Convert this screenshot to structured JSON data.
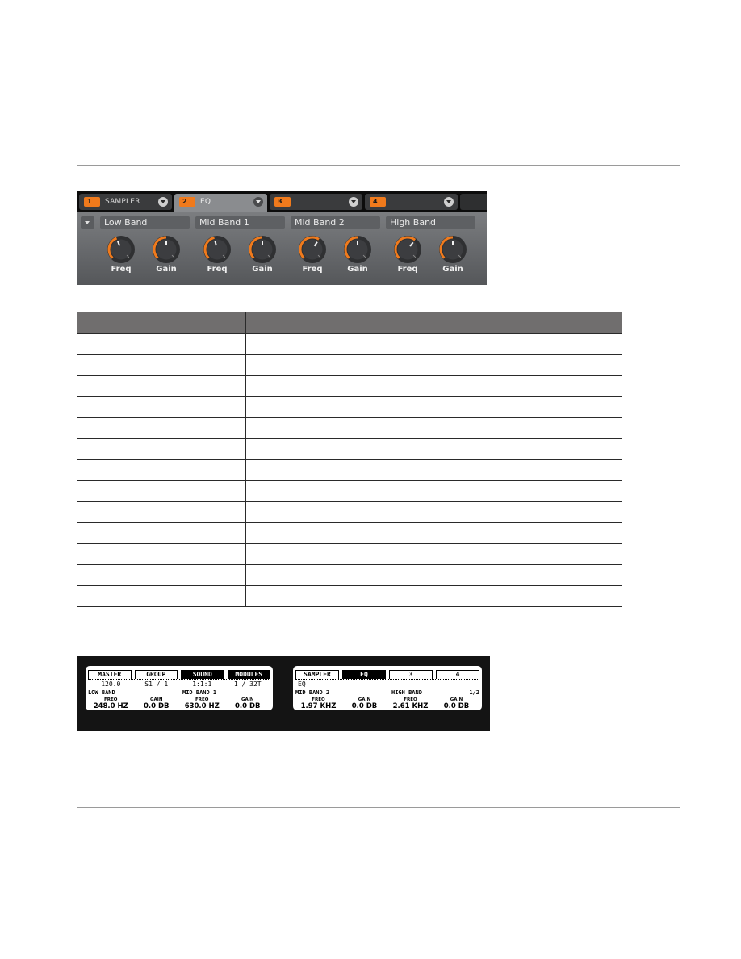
{
  "software_panel": {
    "slots": [
      {
        "number": "1",
        "name": "SAMPLER",
        "active": false
      },
      {
        "number": "2",
        "name": "EQ",
        "active": true
      },
      {
        "number": "3",
        "name": "",
        "active": false
      },
      {
        "number": "4",
        "name": "",
        "active": false
      }
    ],
    "bands": [
      {
        "label": "Low Band",
        "knobs": [
          {
            "label": "Freq",
            "value": 0.42
          },
          {
            "label": "Gain",
            "value": 0.5
          }
        ]
      },
      {
        "label": "Mid Band 1",
        "knobs": [
          {
            "label": "Freq",
            "value": 0.45
          },
          {
            "label": "Gain",
            "value": 0.5
          }
        ]
      },
      {
        "label": "Mid Band 2",
        "knobs": [
          {
            "label": "Freq",
            "value": 0.62
          },
          {
            "label": "Gain",
            "value": 0.5
          }
        ]
      },
      {
        "label": "High Band",
        "knobs": [
          {
            "label": "Freq",
            "value": 0.64
          },
          {
            "label": "Gain",
            "value": 0.5
          }
        ]
      }
    ],
    "accent_color": "#f07a1c"
  },
  "table": {
    "headers": [
      "",
      ""
    ],
    "rows": [
      [
        "",
        ""
      ],
      [
        "",
        ""
      ],
      [
        "",
        ""
      ],
      [
        "",
        ""
      ],
      [
        "",
        ""
      ],
      [
        "",
        ""
      ],
      [
        "",
        ""
      ],
      [
        "",
        ""
      ],
      [
        "",
        ""
      ],
      [
        "",
        ""
      ],
      [
        "",
        ""
      ],
      [
        "",
        ""
      ],
      [
        "",
        ""
      ]
    ]
  },
  "hardware_displays": {
    "left": {
      "tabs": [
        {
          "label": "MASTER",
          "selected": false
        },
        {
          "label": "GROUP",
          "selected": false
        },
        {
          "label": "SOUND",
          "selected": true
        },
        {
          "label": "MODULES",
          "selected": true
        }
      ],
      "row2": [
        "120.0",
        "S1 / 1",
        "1:1:1",
        "1 / 32T"
      ],
      "sections": [
        {
          "title": "LOW BAND",
          "page": ""
        },
        {
          "title": "MID BAND 1",
          "page": ""
        }
      ],
      "params": [
        {
          "caption": "FREQ",
          "value": "248.0 HZ"
        },
        {
          "caption": "GAIN",
          "value": "0.0 DB"
        },
        {
          "caption": "FREQ",
          "value": "630.0 HZ"
        },
        {
          "caption": "GAIN",
          "value": "0.0 DB"
        }
      ]
    },
    "right": {
      "tabs": [
        {
          "label": "SAMPLER",
          "selected": false
        },
        {
          "label": "EQ",
          "selected": true
        },
        {
          "label": "3",
          "selected": false
        },
        {
          "label": "4",
          "selected": false
        }
      ],
      "row2": [
        "EQ"
      ],
      "sections": [
        {
          "title": "MID BAND 2",
          "page": ""
        },
        {
          "title": "HIGH BAND",
          "page": "1/2"
        }
      ],
      "params": [
        {
          "caption": "FREQ",
          "value": "1.97 KHZ"
        },
        {
          "caption": "GAIN",
          "value": "0.0 DB"
        },
        {
          "caption": "FREQ",
          "value": "2.61 KHZ"
        },
        {
          "caption": "GAIN",
          "value": "0.0 DB"
        }
      ]
    }
  }
}
